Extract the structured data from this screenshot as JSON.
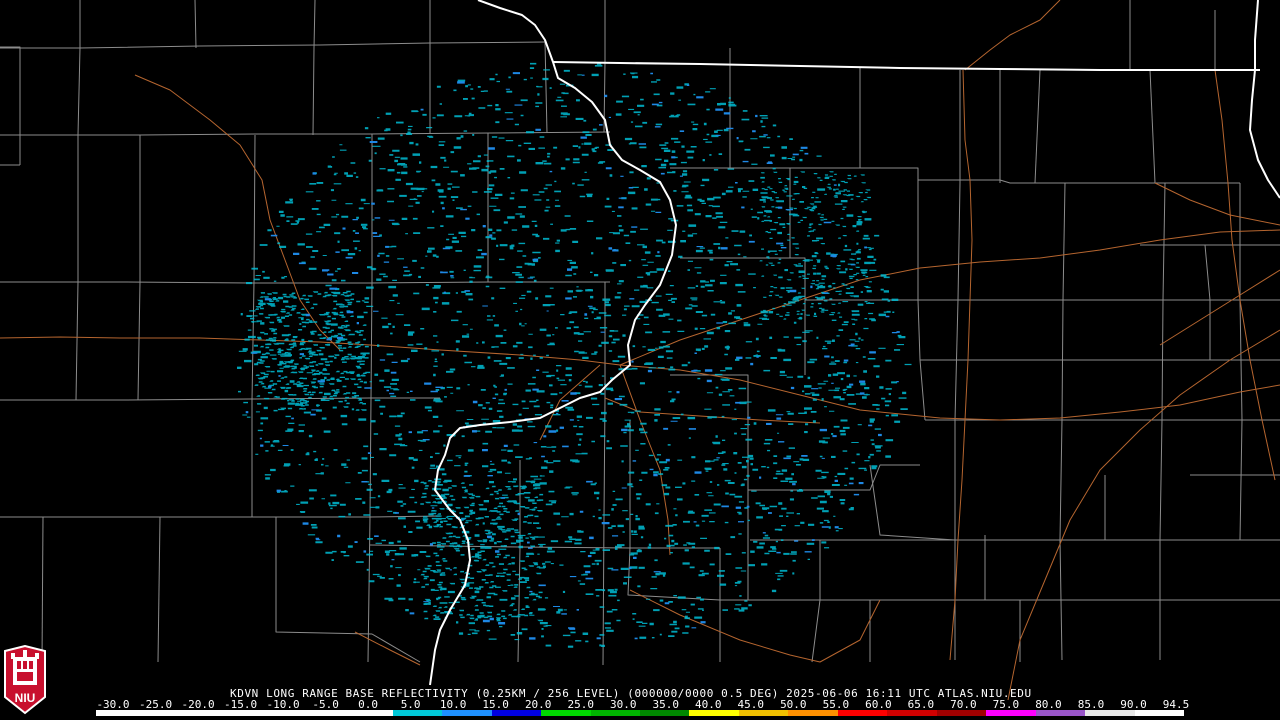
{
  "radar": {
    "title": "KDVN LONG RANGE BASE REFLECTIVITY (0.25KM / 256 LEVEL) (000000/0000 0.5 DEG) 2025-06-06 16:11 UTC  ATLAS.NIU.EDU",
    "station": "KDVN",
    "product": "LONG RANGE BASE REFLECTIVITY",
    "timestamp": "2025-06-06 16:11 UTC",
    "tilt": "0.5 DEG"
  },
  "color_scale": {
    "labels": [
      "-30.0",
      "-25.0",
      "-20.0",
      "-15.0",
      "-10.0",
      "-5.0",
      "0.0",
      "5.0",
      "10.0",
      "15.0",
      "20.0",
      "25.0",
      "30.0",
      "35.0",
      "40.0",
      "45.0",
      "50.0",
      "55.0",
      "60.0",
      "65.0",
      "70.0",
      "75.0",
      "80.0",
      "85.0",
      "90.0",
      "94.5"
    ],
    "colors": [
      "#ffffff",
      "#ffffff",
      "#ffffff",
      "#ffffff",
      "#ffffff",
      "#ffffff",
      "#00c8d8",
      "#1e90ff",
      "#0000e0",
      "#00d800",
      "#00b400",
      "#008800",
      "#ffff00",
      "#f0c000",
      "#ff9000",
      "#ff0000",
      "#d00000",
      "#a00000",
      "#ff00ff",
      "#9955c9",
      "#e8e8e8",
      "#ffffff"
    ]
  },
  "logo": {
    "text": "NIU",
    "icon": "niu-seal-icon",
    "color": "#c8102e"
  },
  "map_colors": {
    "background": "#000000",
    "state_border": "#ffffff",
    "county_line": "#8c8c8c",
    "highway": "#b5652f",
    "echo_primary": "#00bcd4",
    "echo_secondary": "#1e88e5"
  }
}
